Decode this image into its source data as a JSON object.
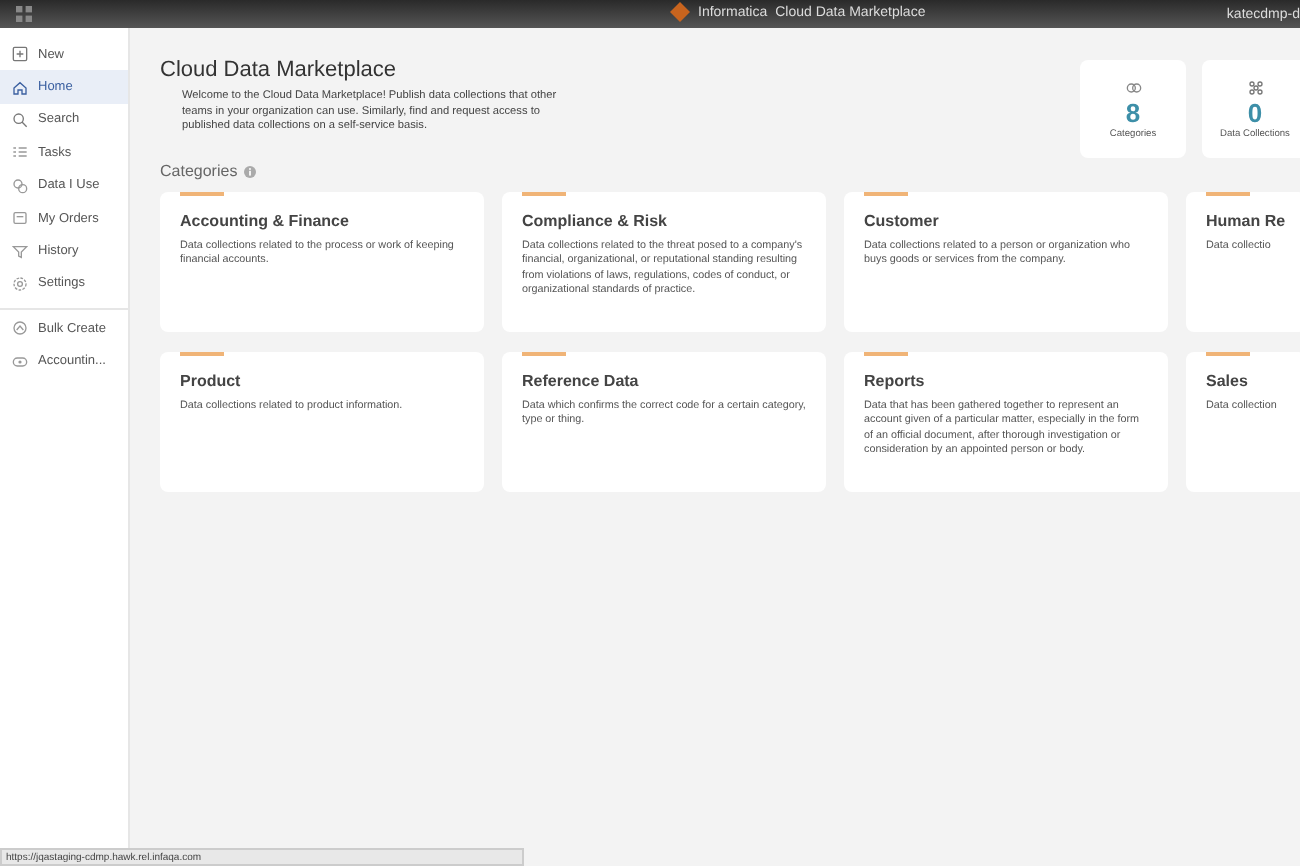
{
  "top_bar": {
    "brand": "Informatica",
    "title": "Cloud Data Marketplace",
    "user": "katecdmp-d"
  },
  "sidebar": {
    "items": [
      {
        "label": "New",
        "selected": false
      },
      {
        "label": "Home",
        "selected": true
      },
      {
        "label": "Search",
        "selected": false
      },
      {
        "label": "Tasks",
        "selected": false
      },
      {
        "label": "Data I Use",
        "selected": false
      },
      {
        "label": "My Orders",
        "selected": false
      },
      {
        "label": "History",
        "selected": false
      },
      {
        "label": "Settings",
        "selected": false
      }
    ],
    "shortcuts": [
      {
        "label": "Bulk Create",
        "selected": false
      },
      {
        "label": "Accountin...",
        "selected": false
      }
    ]
  },
  "page": {
    "title": "Cloud Data Marketplace",
    "intro": "Welcome to the Cloud Data Marketplace! Publish data collections that other teams in your organization can use. Similarly, find and request access to published data collections on a self-service basis.",
    "stats": [
      {
        "value": "8",
        "label": "Categories"
      },
      {
        "value": "0",
        "label": "Data Collections"
      }
    ],
    "categories_heading": "Categories",
    "categories": [
      {
        "title": "Accounting & Finance",
        "description": "Data collections related to the process or work of keeping financial accounts."
      },
      {
        "title": "Compliance & Risk",
        "description": "Data collections related to the threat posed to a company's financial, organizational, or reputational standing resulting from violations of laws, regulations, codes of conduct, or organizational standards of practice."
      },
      {
        "title": "Customer",
        "description": "Data collections related to a person or organization who buys goods or services from the company."
      },
      {
        "title": "Human Re",
        "description": "Data collectio"
      },
      {
        "title": "Product",
        "description": "Data collections related to product information."
      },
      {
        "title": "Reference Data",
        "description": "Data which confirms the correct code for a certain category, type or thing."
      },
      {
        "title": "Reports",
        "description": "Data that has been gathered together to represent an account given of a particular matter, especially in the form of an official document, after thorough investigation or consideration by an appointed person or body."
      },
      {
        "title": "Sales",
        "description": "Data collection"
      }
    ]
  },
  "status_bar": {
    "url": "https://jqastaging-cdmp.hawk.rel.infaqa.com"
  }
}
